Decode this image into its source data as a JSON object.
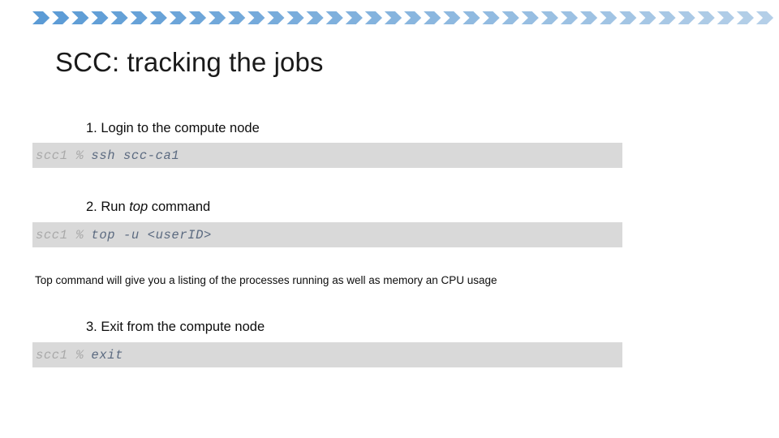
{
  "slide": {
    "title": "SCC: tracking the jobs"
  },
  "banner": {
    "name": "chevron-banner",
    "chevron_count": 38,
    "color_start": "#5b9bd5",
    "color_end": "#b4cfe8"
  },
  "steps": [
    {
      "id": "step-1",
      "number": "1.",
      "text_before": " Login to the compute node",
      "emphasis": "",
      "text_after": ""
    },
    {
      "id": "step-2",
      "number": "2.",
      "text_before": " Run ",
      "emphasis": "top",
      "text_after": " command"
    },
    {
      "id": "step-3",
      "number": "3.",
      "text_before": " Exit from the compute node",
      "emphasis": "",
      "text_after": ""
    }
  ],
  "consoles": [
    {
      "id": "console-1",
      "prompt": "scc1 %",
      "command": "ssh scc-ca1"
    },
    {
      "id": "console-2",
      "prompt": "scc1 %",
      "command": "top -u <userID>"
    },
    {
      "id": "console-3",
      "prompt": "scc1 %",
      "command": "exit"
    }
  ],
  "note": {
    "text": "Top command will give you a listing of the processes running as well as memory an CPU usage"
  },
  "colors": {
    "console_background": "#d9d9d9",
    "prompt_text": "#a9a9a9",
    "command_text": "#5b6a80",
    "body_text": "#0d0d0d",
    "title_text": "#1a1a1a"
  }
}
